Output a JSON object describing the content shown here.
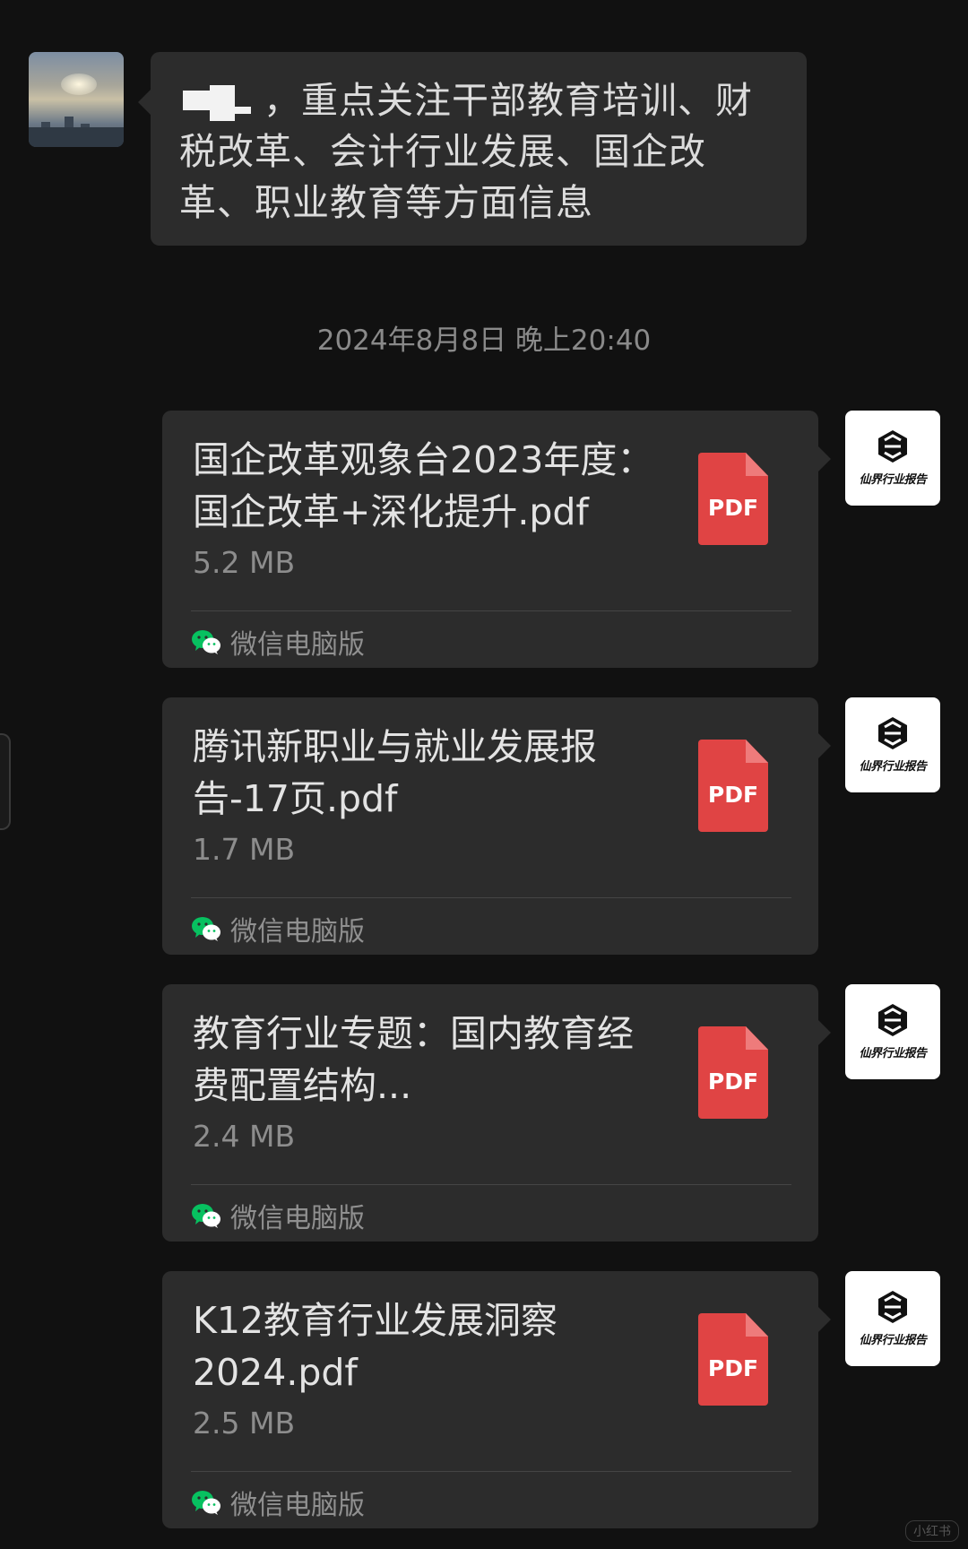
{
  "incoming": {
    "text": "，重点关注干部教育培训、财税改革、会计行业发展、国企改革、职业教育等方面信息"
  },
  "timestamp": "2024年8月8日 晚上20:40",
  "messages": [
    {
      "filename": "国企改革观象台2023年度：国企改革+深化提升.pdf",
      "size": "5.2 MB",
      "file_type": "PDF",
      "source": "微信电脑版"
    },
    {
      "filename": "腾讯新职业与就业发展报告-17页.pdf",
      "size": "1.7 MB",
      "file_type": "PDF",
      "source": "微信电脑版"
    },
    {
      "filename": "教育行业专题：国内教育经费配置结构...",
      "size": "2.4 MB",
      "file_type": "PDF",
      "source": "微信电脑版"
    },
    {
      "filename": "K12教育行业发展洞察2024.pdf",
      "size": "2.5 MB",
      "file_type": "PDF",
      "source": "微信电脑版"
    }
  ],
  "sender_avatar": {
    "brand_text": "仙界行业报告",
    "icon": "cube-logo-icon"
  },
  "watermark": "小红书",
  "colors": {
    "background": "#111111",
    "bubble": "#2c2c2c",
    "pdf_red": "#e04444",
    "wechat_green": "#07c160"
  }
}
